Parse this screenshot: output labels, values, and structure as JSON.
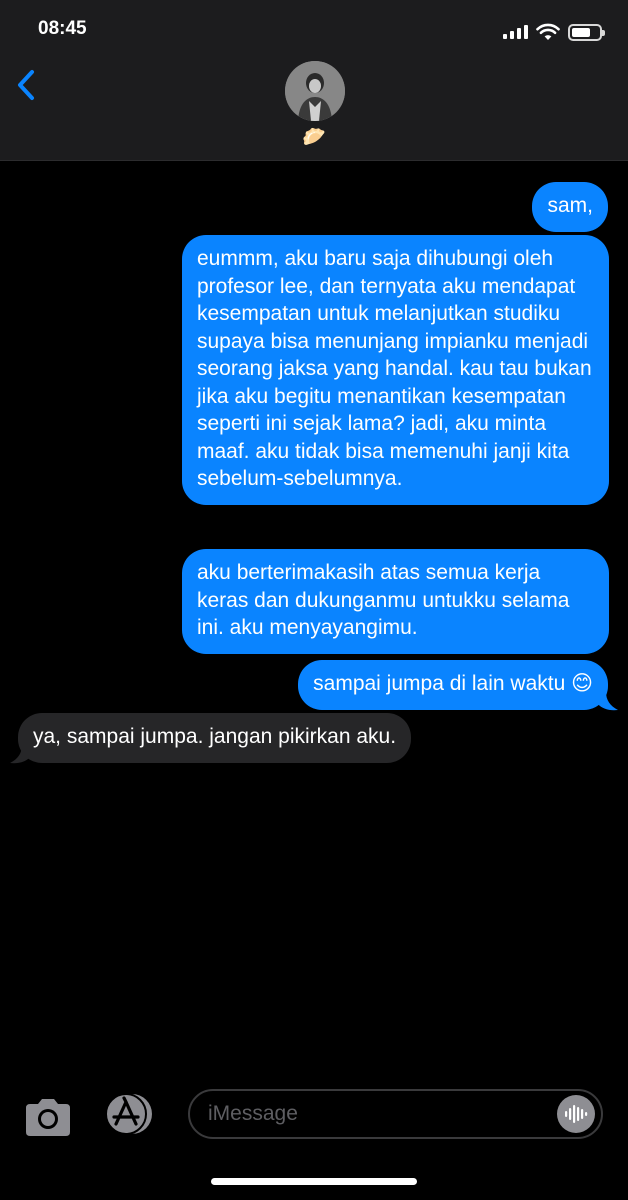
{
  "status_bar": {
    "time": "08:45",
    "battery_level": 0.7
  },
  "header": {
    "contact_name": "🥟"
  },
  "messages": [
    {
      "direction": "sent",
      "text": "sam,"
    },
    {
      "direction": "sent",
      "text": "eummm,  aku baru saja dihubungi oleh profesor lee, dan ternyata aku mendapat kesempatan untuk melanjutkan studiku supaya bisa menunjang impianku menjadi seorang jaksa yang handal. kau tau bukan jika aku begitu menantikan kesempatan seperti ini sejak lama? jadi, aku minta maaf. aku tidak bisa memenuhi janji kita sebelum-sebelumnya."
    },
    {
      "direction": "sent",
      "text": "aku berterimakasih atas semua kerja keras dan dukunganmu untukku selama ini. aku menyayangimu."
    },
    {
      "direction": "sent",
      "text": "sampai jumpa di lain waktu 😊"
    },
    {
      "direction": "received",
      "text": "ya, sampai jumpa. jangan pikirkan aku."
    }
  ],
  "composer": {
    "placeholder": "iMessage"
  },
  "colors": {
    "sent_bubble": "#0a84ff",
    "received_bubble": "#262628",
    "header_bg": "#1c1c1e",
    "background": "#000000"
  }
}
